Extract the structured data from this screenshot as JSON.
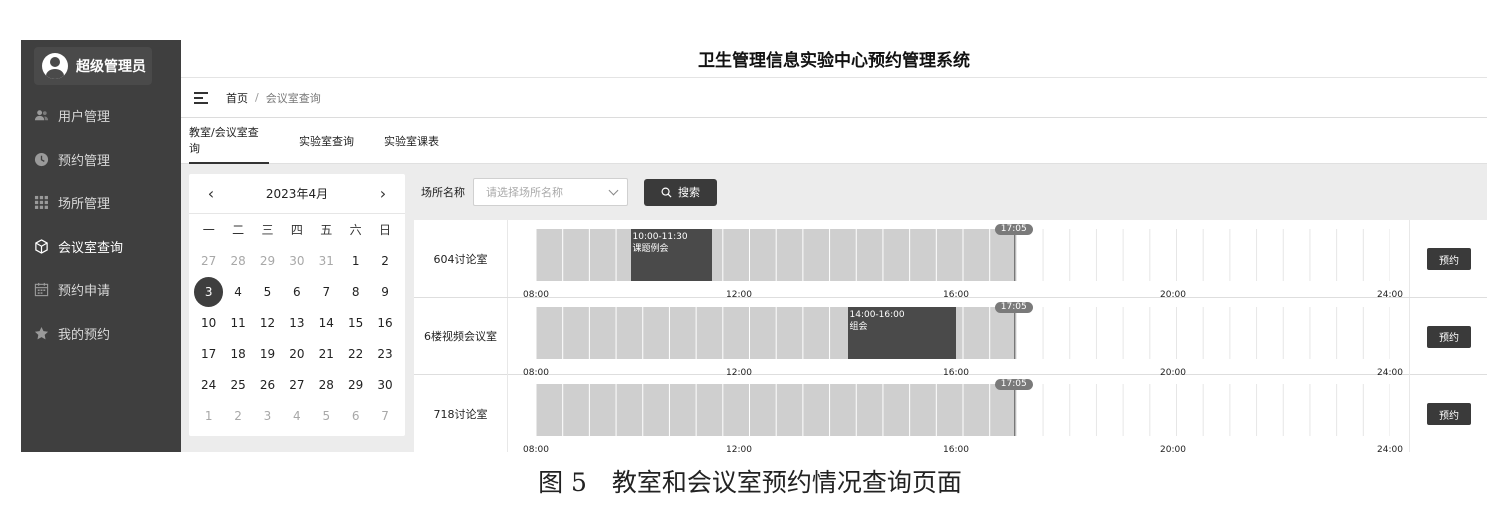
{
  "app": {
    "title": "卫生管理信息实验中心预约管理系统",
    "user": "超级管理员"
  },
  "sidebar": {
    "items": [
      {
        "label": "用户管理",
        "icon": "users-icon"
      },
      {
        "label": "预约管理",
        "icon": "clock-icon"
      },
      {
        "label": "场所管理",
        "icon": "grid-icon"
      },
      {
        "label": "会议室查询",
        "icon": "cube-icon",
        "active": true
      },
      {
        "label": "预约申请",
        "icon": "calendar-icon"
      },
      {
        "label": "我的预约",
        "icon": "star-icon"
      }
    ]
  },
  "breadcrumb": {
    "home": "首页",
    "separator": "/",
    "current": "会议室查询"
  },
  "tabs": [
    {
      "label": "教室/会议室查询",
      "active": true
    },
    {
      "label": "实验室查询"
    },
    {
      "label": "实验室课表"
    }
  ],
  "calendar": {
    "title": "2023年4月",
    "prev": "‹",
    "next": "›",
    "weekdays": [
      "一",
      "二",
      "三",
      "四",
      "五",
      "六",
      "日"
    ],
    "weeks": [
      [
        "27",
        "28",
        "29",
        "30",
        "31",
        "1",
        "2"
      ],
      [
        "3",
        "4",
        "5",
        "6",
        "7",
        "8",
        "9"
      ],
      [
        "10",
        "11",
        "12",
        "13",
        "14",
        "15",
        "16"
      ],
      [
        "17",
        "18",
        "19",
        "20",
        "21",
        "22",
        "23"
      ],
      [
        "24",
        "25",
        "26",
        "27",
        "28",
        "29",
        "30"
      ],
      [
        "1",
        "2",
        "3",
        "4",
        "5",
        "6",
        "7"
      ]
    ],
    "selected": "3"
  },
  "filter": {
    "label": "场所名称",
    "placeholder": "请选择场所名称",
    "search_label": "搜索"
  },
  "schedule": {
    "day_start_hour": 8,
    "day_end_hour": 24,
    "ticks": [
      "08:00",
      "12:00",
      "16:00",
      "20:00",
      "24:00"
    ],
    "now": "17:05",
    "now_hour": 17.083,
    "book_label": "预约",
    "rooms": [
      {
        "name": "604讨论室",
        "bookings": [
          {
            "time": "10:00-11:30",
            "title": "课题例会",
            "start": 10,
            "end": 11.5
          }
        ]
      },
      {
        "name": "6楼视频会议室",
        "bookings": [
          {
            "time": "14:00-16:00",
            "title": "组会",
            "start": 14,
            "end": 16
          }
        ]
      },
      {
        "name": "718讨论室",
        "bookings": []
      }
    ]
  },
  "colors": {
    "sidebar": "#3f3f3f",
    "past_slot": "#cfcfcf",
    "booking": "#4a4a4a",
    "button": "#3a3a3a"
  },
  "caption": "图 5　教室和会议室预约情况查询页面"
}
